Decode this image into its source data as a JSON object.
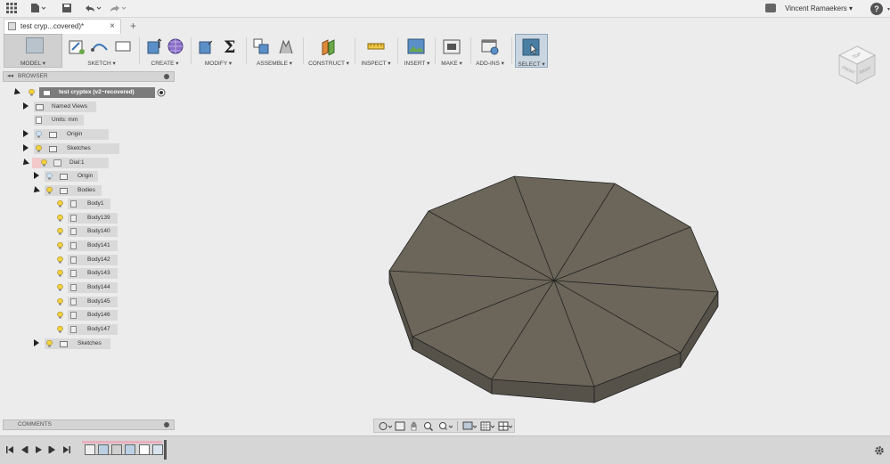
{
  "topbar": {
    "user_name": "Vincent Ramaekers",
    "help_label": "?"
  },
  "tab": {
    "title": "test cryp...covered)*",
    "close": "×",
    "new": "+"
  },
  "workspace": {
    "label": "MODEL ▾"
  },
  "ribbon": {
    "sketch": "SKETCH ▾",
    "create": "CREATE ▾",
    "modify": "MODIFY ▾",
    "assemble": "ASSEMBLE ▾",
    "construct": "CONSTRUCT ▾",
    "inspect": "INSPECT ▾",
    "insert": "INSERT ▾",
    "make": "MAKE ▾",
    "addins": "ADD-INS ▾",
    "select": "SELECT ▾"
  },
  "viewcube": {
    "top": "TOP",
    "front": "FRONT",
    "right": "RIGHT"
  },
  "browser": {
    "title": "BROWSER",
    "root": "test cryptex (v2~recovered)",
    "named_views": "Named Views",
    "units": "Units: mm",
    "origin": "Origin",
    "sketches": "Sketches",
    "dial": "Dial:1",
    "dial_origin": "Origin",
    "bodies": "Bodies",
    "body_items": [
      "Body1",
      "Body139",
      "Body140",
      "Body141",
      "Body142",
      "Body143",
      "Body144",
      "Body145",
      "Body146",
      "Body147"
    ],
    "dial_sketches": "Sketches"
  },
  "comments": {
    "title": "COMMENTS"
  },
  "colors": {
    "model_top": "#6b6659",
    "model_side": "#56524a",
    "accent_select": "#4a7fa3"
  }
}
